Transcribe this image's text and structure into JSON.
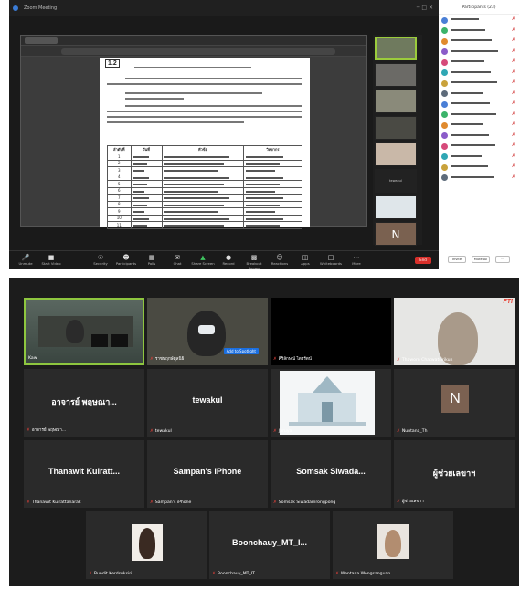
{
  "colors": {
    "active_border": "#8ec63f",
    "mute_red": "#e0403a",
    "share_green": "#3ec35f",
    "leave_red": "#d9302b",
    "spotlight_blue": "#1b6fe0"
  },
  "top": {
    "window_title": "Zoom Meeting",
    "doc": {
      "section_number": "1.2",
      "table_headers": [
        "ลำดับที่",
        "วันที่",
        "หัวข้อ",
        "วิทยากร"
      ],
      "row_numbers": [
        "1",
        "2",
        "3",
        "4",
        "5",
        "6",
        "7",
        "8",
        "9",
        "10",
        "11"
      ]
    },
    "right_strip": {
      "waiting_label": "tewakul",
      "avatar_letter": "N"
    },
    "toolbar": {
      "mute": "Unmute",
      "video": "Start Video",
      "security": "Security",
      "participants": "Participants",
      "polls": "Polls",
      "chat": "Chat",
      "share": "Share Screen",
      "record": "Record",
      "breakout": "Breakout Rooms",
      "reactions": "Reactions",
      "apps": "Apps",
      "whiteboards": "Whiteboards",
      "more": "More",
      "leave": "End"
    },
    "participants_panel": {
      "title": "Participants (23)",
      "invite_label": "Invite",
      "mute_all_label": "Mute All"
    }
  },
  "bottom": {
    "tiles": {
      "t1": {
        "name": "Kaw"
      },
      "t2": {
        "name": "ราชพฤกษ์มูลนิธิ",
        "spotlight": "Add to Spotlight"
      },
      "t3": {
        "name": "ศิริลักษณ์ ไตรรัตน์"
      },
      "t4": {
        "name": "Thaworn Chatwatsirikun",
        "logo": "FTI"
      },
      "t5": {
        "big": "อาจารย์ พฤษณา...",
        "name": "อาจารย์ พฤษณา..."
      },
      "t6": {
        "big": "tewakul",
        "name": "tewakul"
      },
      "t7": {
        "name": "Jaruya"
      },
      "t8": {
        "letter": "N",
        "name": "Nuntana_Th"
      },
      "t9": {
        "big": "Thanawit Kulratt...",
        "name": "Thanawit Kulrattanarak"
      },
      "t10": {
        "big": "Sampan's iPhone",
        "name": "Sampan's iPhone"
      },
      "t11": {
        "big": "Somsak Siwada...",
        "name": "Somsak Siwadamrongpong"
      },
      "t12": {
        "big": "ผู้ช่วยเลขาฯ",
        "name": "ผู้ช่วยเลขาฯ"
      },
      "t13": {
        "name": "Bundit Kerdsuksiri"
      },
      "t14": {
        "big": "Boonchauy_MT_I...",
        "name": "Boonchauy_MT_IT"
      },
      "t15": {
        "name": "Wantana Wongsanguan"
      }
    }
  }
}
